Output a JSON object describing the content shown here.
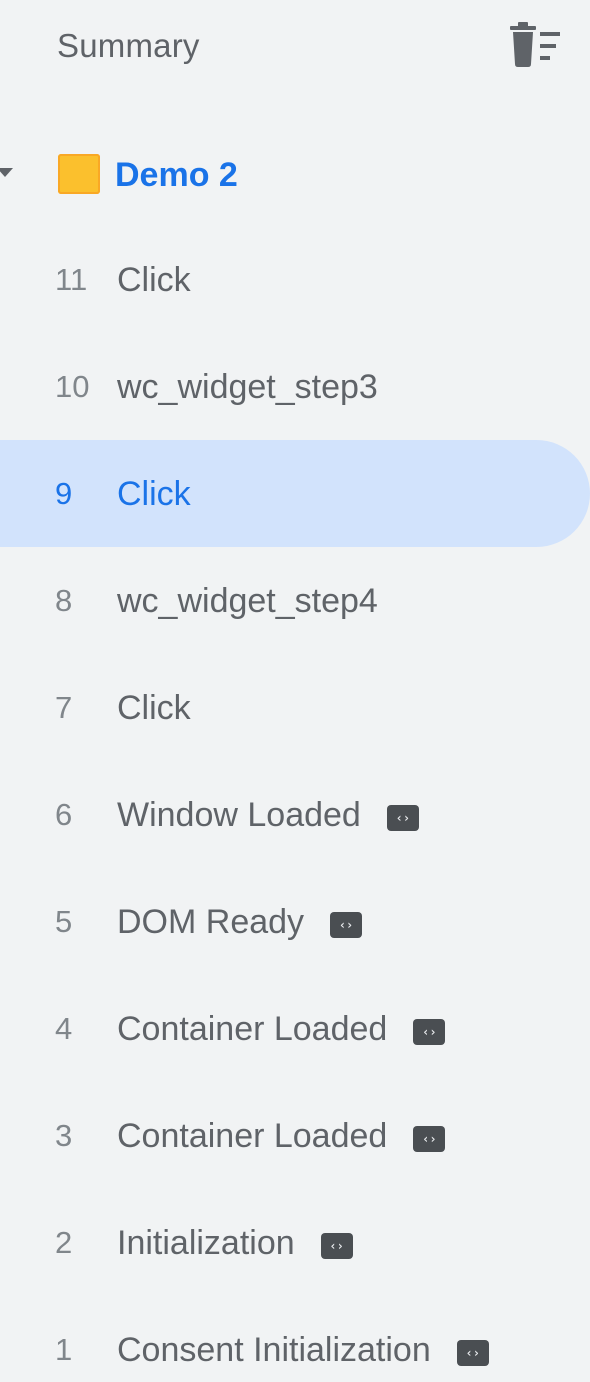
{
  "header": {
    "title": "Summary",
    "clear_icon": "delete-sweep-icon"
  },
  "container": {
    "label": "Demo 2",
    "expanded": true,
    "icon": "container-folder-icon",
    "color": "#fbc02d"
  },
  "events": [
    {
      "num": "11",
      "label": "Click",
      "selected": false,
      "badge": false
    },
    {
      "num": "10",
      "label": "wc_widget_step3",
      "selected": false,
      "badge": false
    },
    {
      "num": "9",
      "label": "Click",
      "selected": true,
      "badge": false
    },
    {
      "num": "8",
      "label": "wc_widget_step4",
      "selected": false,
      "badge": false
    },
    {
      "num": "7",
      "label": "Click",
      "selected": false,
      "badge": false
    },
    {
      "num": "6",
      "label": "Window Loaded",
      "selected": false,
      "badge": true
    },
    {
      "num": "5",
      "label": "DOM Ready",
      "selected": false,
      "badge": true
    },
    {
      "num": "4",
      "label": "Container Loaded",
      "selected": false,
      "badge": true
    },
    {
      "num": "3",
      "label": "Container Loaded",
      "selected": false,
      "badge": true
    },
    {
      "num": "2",
      "label": "Initialization",
      "selected": false,
      "badge": true
    },
    {
      "num": "1",
      "label": "Consent Initialization",
      "selected": false,
      "badge": true
    }
  ],
  "badge_icon": "code-icon",
  "colors": {
    "accent": "#1a73e8",
    "selected_bg": "#d2e3fc",
    "panel_bg": "#f1f3f4"
  }
}
